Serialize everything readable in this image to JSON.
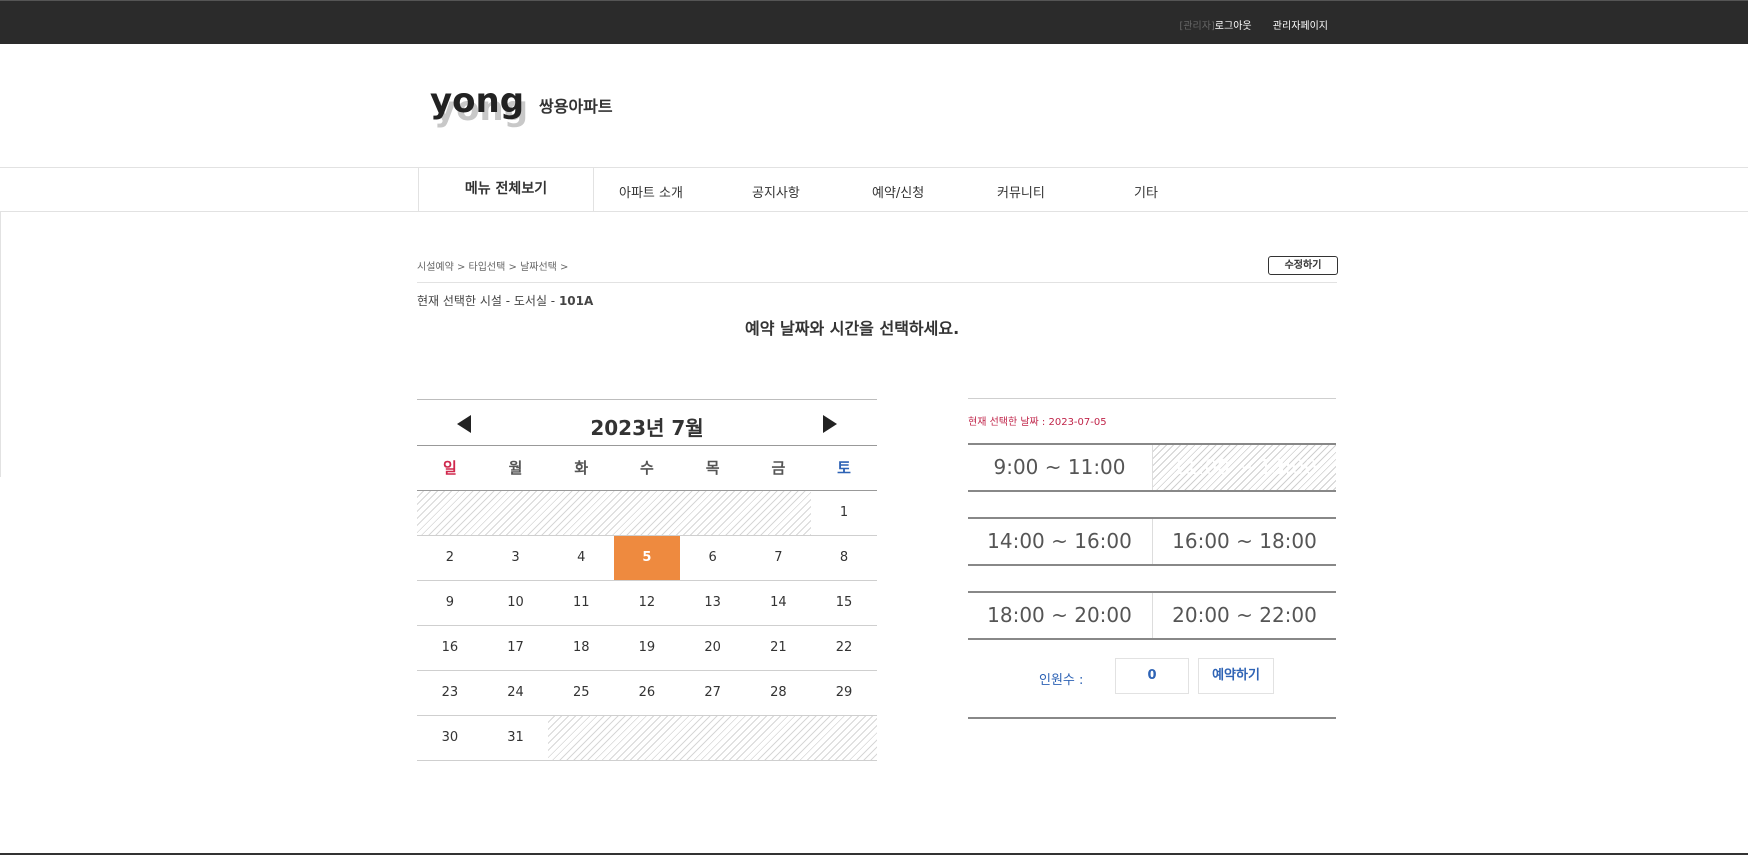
{
  "topbar": {
    "role": "[관리자]",
    "logout": "로그아웃",
    "admin_page": "관리자페이지"
  },
  "header": {
    "logo_text": "yong",
    "logo_shadow": "yong",
    "site_name": "쌍용아파트"
  },
  "nav": {
    "items": [
      "메뉴 전체보기",
      "아파트 소개",
      "공지사항",
      "예약/신청",
      "커뮤니티",
      "기타"
    ]
  },
  "breadcrumb": "시설예약 > 타입선택 > 날짜선택 >",
  "edit_button": "수정하기",
  "current_facility": {
    "prefix": "현재 선택한 시설 - 도서실 - ",
    "room": "101A"
  },
  "instruction": "예약 날짜와 시간을 선택하세요.",
  "calendar": {
    "title": "2023년 7월",
    "weekdays": [
      "일",
      "월",
      "화",
      "수",
      "목",
      "금",
      "토"
    ],
    "selected_day": "5",
    "weeks": [
      [
        "",
        "",
        "",
        "",
        "",
        "",
        "1"
      ],
      [
        "2",
        "3",
        "4",
        "5",
        "6",
        "7",
        "8"
      ],
      [
        "9",
        "10",
        "11",
        "12",
        "13",
        "14",
        "15"
      ],
      [
        "16",
        "17",
        "18",
        "19",
        "20",
        "21",
        "22"
      ],
      [
        "23",
        "24",
        "25",
        "26",
        "27",
        "28",
        "29"
      ],
      [
        "30",
        "31",
        "",
        "",
        "",
        "",
        ""
      ]
    ]
  },
  "timeslots": {
    "selected_date_label": "현재 선택한 날짜 : 2023-07-05",
    "rows": [
      [
        "9:00 ~ 11:00",
        "11:00 ~ 13:00"
      ],
      [
        "14:00 ~ 16:00",
        "16:00 ~ 18:00"
      ],
      [
        "18:00 ~ 20:00",
        "20:00 ~ 22:00"
      ]
    ],
    "disabled": [
      "11:00 ~ 13:00"
    ]
  },
  "booking": {
    "people_label": "인원수 :",
    "people_value": "0",
    "book_button": "예약하기"
  },
  "colors": {
    "topbar_bg": "#2b2b2b",
    "selected_day": "#ee8a3f",
    "sunday": "#d0284d",
    "saturday": "#2e63b5",
    "date_label": "#c0254a"
  }
}
